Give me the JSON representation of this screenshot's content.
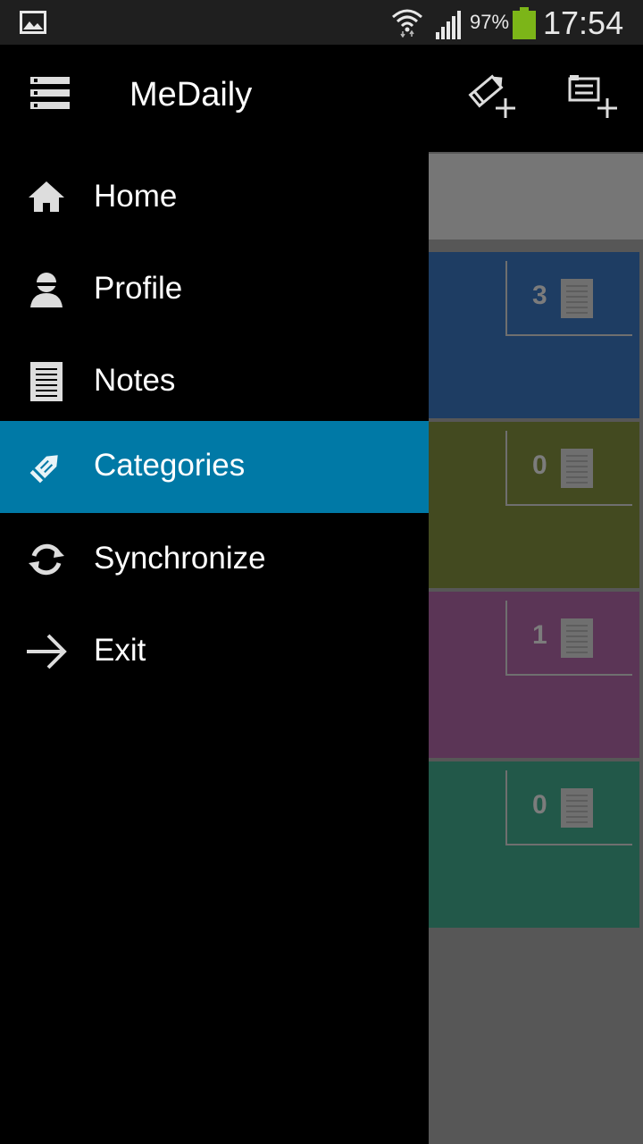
{
  "status_bar": {
    "battery": "97%",
    "time": "17:54"
  },
  "action_bar": {
    "title": "MeDaily",
    "menu_icon": "drawer-menu-icon",
    "new_note_icon": "pencil-plus-icon",
    "new_category_icon": "card-plus-icon"
  },
  "drawer": {
    "items": [
      {
        "label": "Home",
        "icon": "home-icon",
        "active": false
      },
      {
        "label": "Profile",
        "icon": "person-icon",
        "active": false
      },
      {
        "label": "Notes",
        "icon": "notes-icon",
        "active": false
      },
      {
        "label": "Categories",
        "icon": "pencil-tag-icon",
        "active": true
      },
      {
        "label": "Synchronize",
        "icon": "sync-icon",
        "active": false
      },
      {
        "label": "Exit",
        "icon": "arrow-right-icon",
        "active": false
      }
    ]
  },
  "categories": [
    {
      "count": "3",
      "color": "#1e3d63"
    },
    {
      "count": "0",
      "color": "#434a20"
    },
    {
      "count": "1",
      "color": "#5b3556"
    },
    {
      "count": "0",
      "color": "#225849"
    }
  ],
  "colors": {
    "accent": "#0079a6",
    "status_bar": "#1f1f1f",
    "battery": "#7cb518"
  }
}
